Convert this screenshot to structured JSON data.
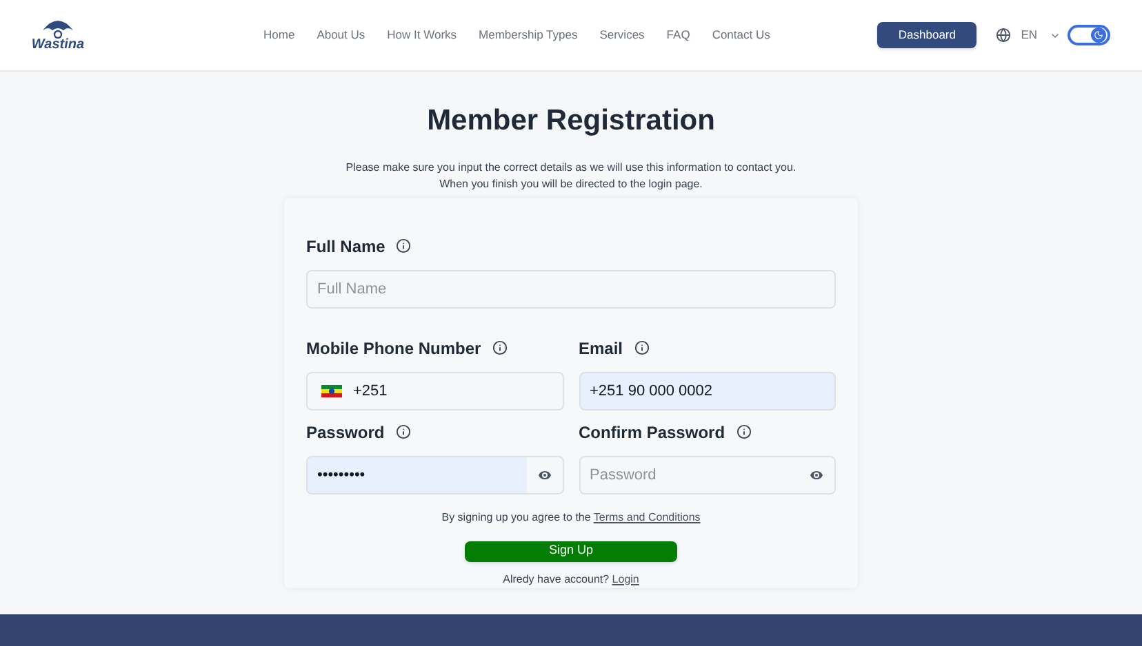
{
  "header": {
    "logo": "Wastina",
    "nav": [
      {
        "label": "Home"
      },
      {
        "label": "About Us"
      },
      {
        "label": "How It Works"
      },
      {
        "label": "Membership Types"
      },
      {
        "label": "Services"
      },
      {
        "label": "FAQ"
      },
      {
        "label": "Contact Us"
      }
    ],
    "dashboard_button": "Dashboard",
    "language": "EN",
    "theme_toggle": {
      "on": true
    }
  },
  "title": "Member Registration",
  "intro": "Please make sure you input the correct details as we will use this information to contact you. When you finish you will be directed to the login page.",
  "form": {
    "rows": [
      [
        {
          "kind": "text",
          "label": "Full Name",
          "placeholder": "Full Name",
          "autofilled": false
        }
      ],
      [
        {
          "kind": "phone",
          "label": "Mobile Phone Number",
          "value": "+251",
          "autofilled": false
        },
        {
          "kind": "text",
          "label": "Email",
          "value": "+251 90 000 0002",
          "autofilled": true
        }
      ],
      [
        {
          "kind": "password",
          "label": "Password",
          "value": "•••••••••",
          "autofilled": true
        },
        {
          "kind": "password",
          "label": "Confirm Password",
          "placeholder": "Password",
          "autofilled": false
        }
      ]
    ],
    "terms_text": "By signing up you agree to the",
    "terms_link": "Terms and Conditions",
    "submit": "Sign Up",
    "login_text": "Alredy have account?",
    "login_link": "Login"
  }
}
